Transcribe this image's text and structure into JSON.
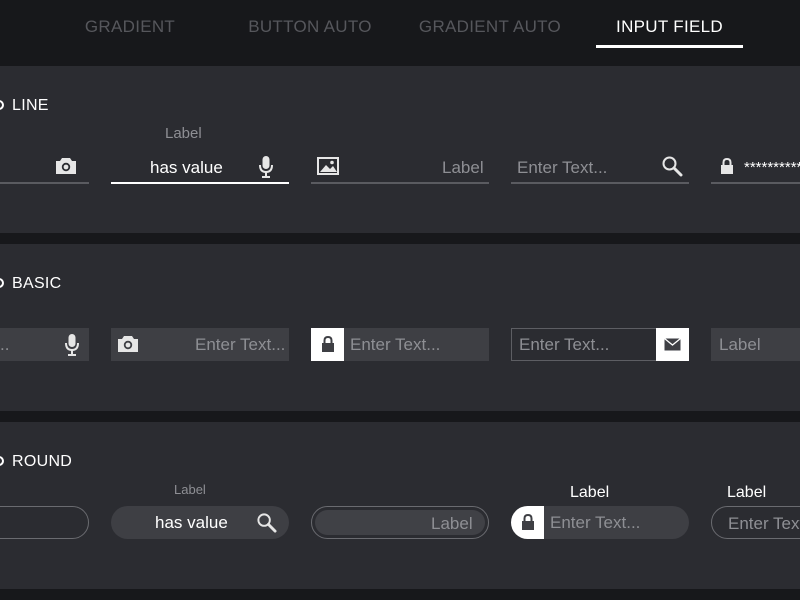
{
  "tabs": [
    {
      "label": "GRADIENT"
    },
    {
      "label": "BUTTON AUTO"
    },
    {
      "label": "GRADIENT AUTO"
    },
    {
      "label": "INPUT FIELD",
      "active": true
    }
  ],
  "sections": {
    "line": {
      "title": "LINE",
      "field_label": "Label",
      "field_value": "has value",
      "image_field_label": "Label",
      "search_placeholder": "Enter Text...",
      "password_value": "**********"
    },
    "basic": {
      "title": "BASIC",
      "partial_text": "..",
      "camera_placeholder": "Enter Text...",
      "lock_placeholder": "Enter Text...",
      "mail_placeholder": "Enter Text...",
      "last_label": "Label"
    },
    "round": {
      "title": "ROUND",
      "search_label": "Label",
      "search_value": "has value",
      "inset_label": "Label",
      "lock_label": "Label",
      "lock_placeholder": "Enter Text...",
      "last_label": "Label",
      "last_placeholder": "Enter Text"
    }
  },
  "colors": {
    "background": "#17181b",
    "panel": "#2b2c31",
    "field_fill": "#3e3f44",
    "muted_text": "#8e8f94",
    "active": "#ffffff"
  }
}
